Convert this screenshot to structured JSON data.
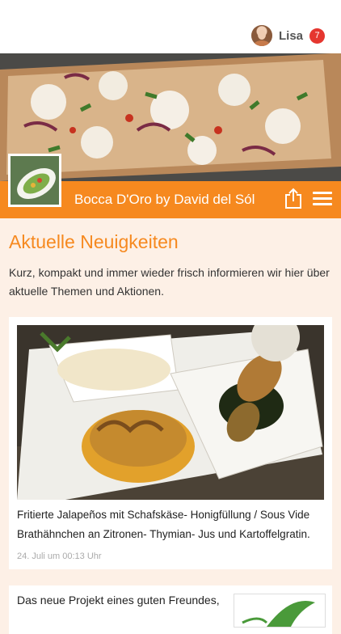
{
  "user": {
    "name": "Lisa",
    "notification_count": "7"
  },
  "venue": {
    "title": "Bocca D'Oro by David del Sól"
  },
  "news": {
    "heading": "Aktuelle Neuigkeiten",
    "intro": "Kurz, kompakt und immer wieder frisch informieren wir hier über aktuelle Themen und Aktionen.",
    "items": [
      {
        "caption": "Fritierte Jalapeños mit Schafskäse- Honigfüllung / Sous Vide Brathähnchen an Zitronen- Thymian- Jus und Kartoffelgratin.",
        "date": "24. Juli um 00:13 Uhr"
      },
      {
        "caption": "Das neue Projekt eines guten Freundes,"
      }
    ]
  },
  "colors": {
    "accent": "#f6891f",
    "badge": "#e5362f",
    "background": "#fdf0e6"
  },
  "icons": {
    "share": "share-icon",
    "menu": "hamburger-menu-icon"
  }
}
